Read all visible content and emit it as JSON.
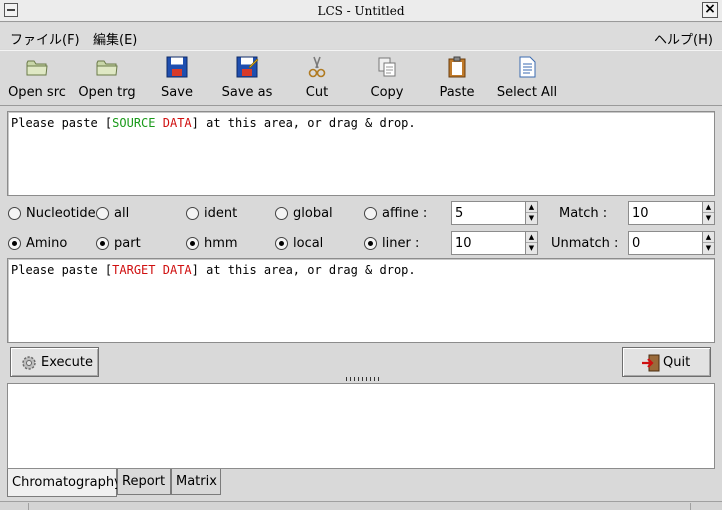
{
  "window": {
    "title": "LCS - Untitled"
  },
  "menu": {
    "file": "ファイル(F)",
    "edit": "編集(E)",
    "help": "ヘルプ(H)"
  },
  "toolbar": {
    "open_src": "Open src",
    "open_trg": "Open trg",
    "save": "Save",
    "save_as": "Save as",
    "cut": "Cut",
    "copy": "Copy",
    "paste": "Paste",
    "select_all": "Select All"
  },
  "source": {
    "pre": "Please paste [",
    "w1": "SOURCE",
    "sp": " ",
    "w2": "DATA",
    "post": "] at this area, or drag & drop."
  },
  "options": {
    "nucleotide": "Nucleotide",
    "amino": "Amino",
    "all": "all",
    "part": "part",
    "ident": "ident",
    "hmm": "hmm",
    "global": "global",
    "local": "local",
    "affine": "affine :",
    "liner": "liner :",
    "affine_value": "5",
    "liner_value": "10",
    "match_label": "Match :",
    "match_value": "10",
    "unmatch_label": "Unmatch :",
    "unmatch_value": "0"
  },
  "target": {
    "pre": "Please paste [",
    "w1": "TARGET",
    "sp": " ",
    "w2": "DATA",
    "post": "] at this area, or drag & drop."
  },
  "actions": {
    "execute": "Execute",
    "quit": "Quit"
  },
  "tabs": {
    "chromatography": "Chromatography",
    "report": "Report",
    "matrix": "Matrix"
  },
  "colors": {
    "red": "#d01010",
    "green": "#1a9a1a",
    "orange": "#d07a00"
  }
}
